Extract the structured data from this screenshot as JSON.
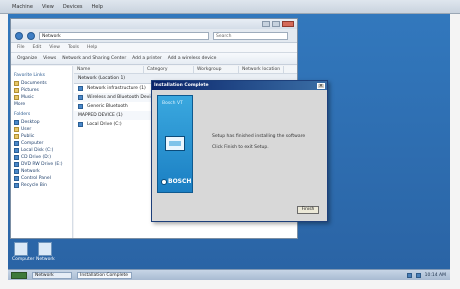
{
  "viewer": {
    "menu": [
      "Machine",
      "View",
      "Devices",
      "Help"
    ]
  },
  "explorer": {
    "address": "Network",
    "search_placeholder": "Search",
    "menu": [
      "File",
      "Edit",
      "View",
      "Tools",
      "Help"
    ],
    "toolbar": [
      "Organize",
      "Views",
      "Network and Sharing Center",
      "Add a printer",
      "Add a wireless device"
    ],
    "sidebar_favorites_title": "Favorite Links",
    "sidebar_favorites": [
      "Documents",
      "Pictures",
      "Music",
      "More"
    ],
    "sidebar_folders_title": "Folders",
    "sidebar_folders": [
      "Desktop",
      "User",
      "Public",
      "Computer",
      "Local Disk (C:)",
      "CD Drive (D:)",
      "DVD RW Drive (E:)",
      "Network",
      "Control Panel",
      "Recycle Bin"
    ],
    "columns": [
      "Name",
      "Category",
      "Workgroup",
      "Network location"
    ],
    "tab_label": "Network (Location 1)",
    "rows": [
      "Network infrastructure (1)",
      "Wireless and Bluetooth Devices",
      "Generic Bluetooth",
      "MAPPED DEVICE (1)",
      "Local Drive (C:)"
    ]
  },
  "dialog": {
    "title": "Installation Complete",
    "banner_text": "Bosch VT",
    "brand": "BOSCH",
    "body_lines": [
      "Setup has finished installing the software",
      "Click Finish to exit Setup."
    ],
    "button_label": "Finish",
    "close_glyph": "×"
  },
  "desktop_icons": [
    {
      "label": "Computer"
    },
    {
      "label": "Network"
    }
  ],
  "taskbar": {
    "task_label": "Network",
    "active_label": "Installation Complete",
    "clock": "10:14 AM"
  }
}
